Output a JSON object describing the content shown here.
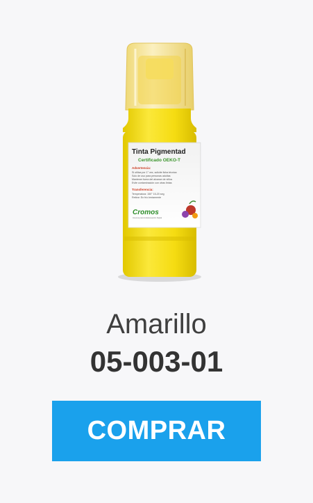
{
  "product": {
    "name": "Amarillo",
    "code": "05-003-01",
    "image": {
      "label_title": "Tinta Pigmentad",
      "label_subtitle": "Certificado OEKO-T",
      "label_warning_heading": "Advertencia:",
      "label_warning_lines": [
        "Si utiliza por 1° vez, solicite ficha técnica",
        "Solo de uso para personas adultas",
        "Mantener fuera del alcance de niños",
        "Evite contaminación con otras tintas"
      ],
      "label_transfer_heading": "Transferencia:",
      "label_transfer_lines": [
        "Temperatura: 150° 15-20 seg",
        "Retirar: En frío lentamente"
      ],
      "brand": "Cromos",
      "brand_tagline": "Insumos para la Estampación Digital",
      "ink_color": "#f7e12a",
      "cap_color": "#f4e39a"
    }
  },
  "actions": {
    "buy_label": "COMPRAR",
    "buy_color": "#1aa1ec"
  }
}
